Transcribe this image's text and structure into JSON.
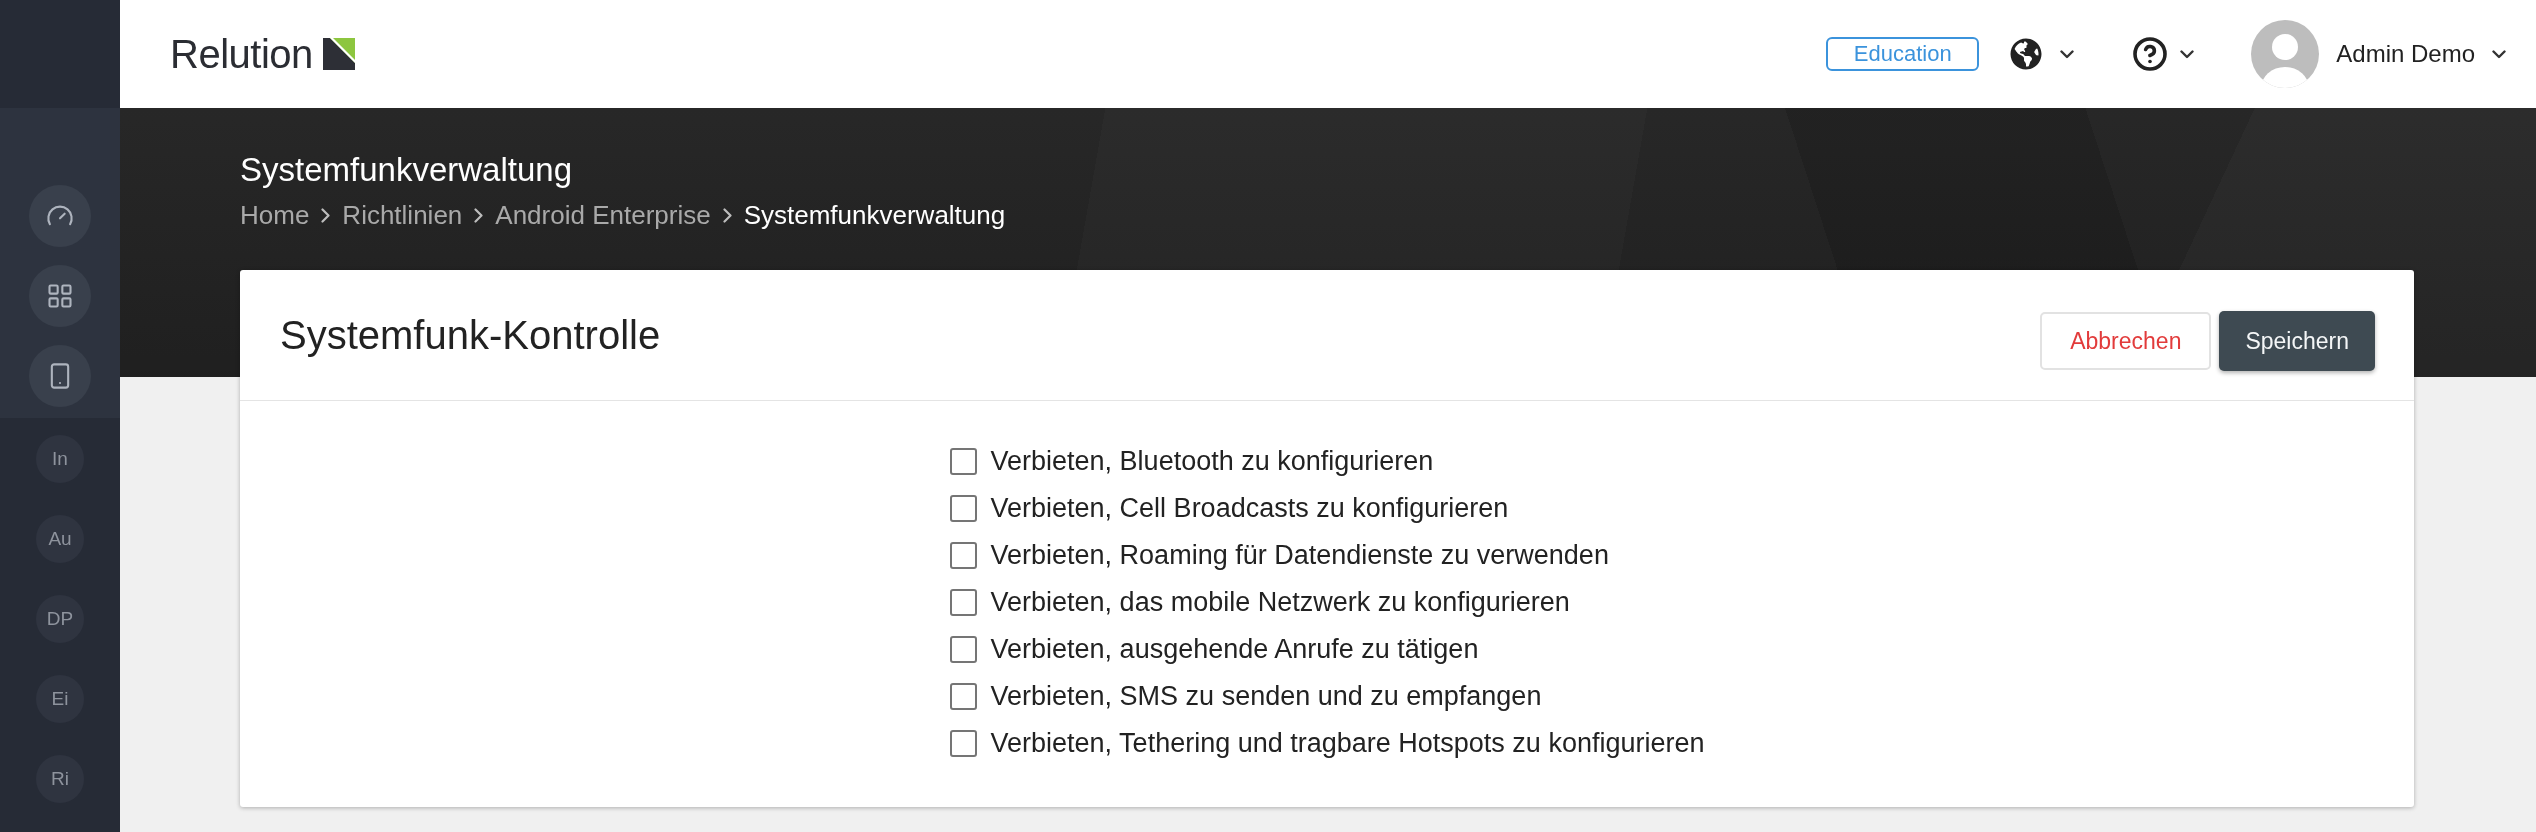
{
  "header": {
    "logo": "Relution",
    "badge": "Education",
    "user_name": "Admin Demo"
  },
  "sidebar": {
    "shortcuts": [
      "In",
      "Au",
      "DP",
      "Ei",
      "Ri"
    ]
  },
  "banner": {
    "title": "Systemfunkverwaltung",
    "breadcrumb": [
      {
        "label": "Home",
        "current": false
      },
      {
        "label": "Richtlinien",
        "current": false
      },
      {
        "label": "Android Enterprise",
        "current": false
      },
      {
        "label": "Systemfunkverwaltung",
        "current": true
      }
    ]
  },
  "card": {
    "title": "Systemfunk-Kontrolle",
    "buttons": [
      {
        "label": "Abbrechen",
        "kind": "secondary"
      },
      {
        "label": "Speichern",
        "kind": "primary"
      }
    ],
    "options": [
      {
        "label": "Verbieten, Bluetooth zu konfigurieren",
        "checked": false
      },
      {
        "label": "Verbieten, Cell Broadcasts zu konfigurieren",
        "checked": false
      },
      {
        "label": "Verbieten, Roaming für Datendienste zu verwenden",
        "checked": false
      },
      {
        "label": "Verbieten, das mobile Netzwerk zu konfigurieren",
        "checked": false
      },
      {
        "label": "Verbieten, ausgehende Anrufe zu tätigen",
        "checked": false
      },
      {
        "label": "Verbieten, SMS zu senden und zu empfangen",
        "checked": false
      },
      {
        "label": "Verbieten, Tethering und tragbare Hotspots zu konfigurieren",
        "checked": false
      }
    ]
  }
}
